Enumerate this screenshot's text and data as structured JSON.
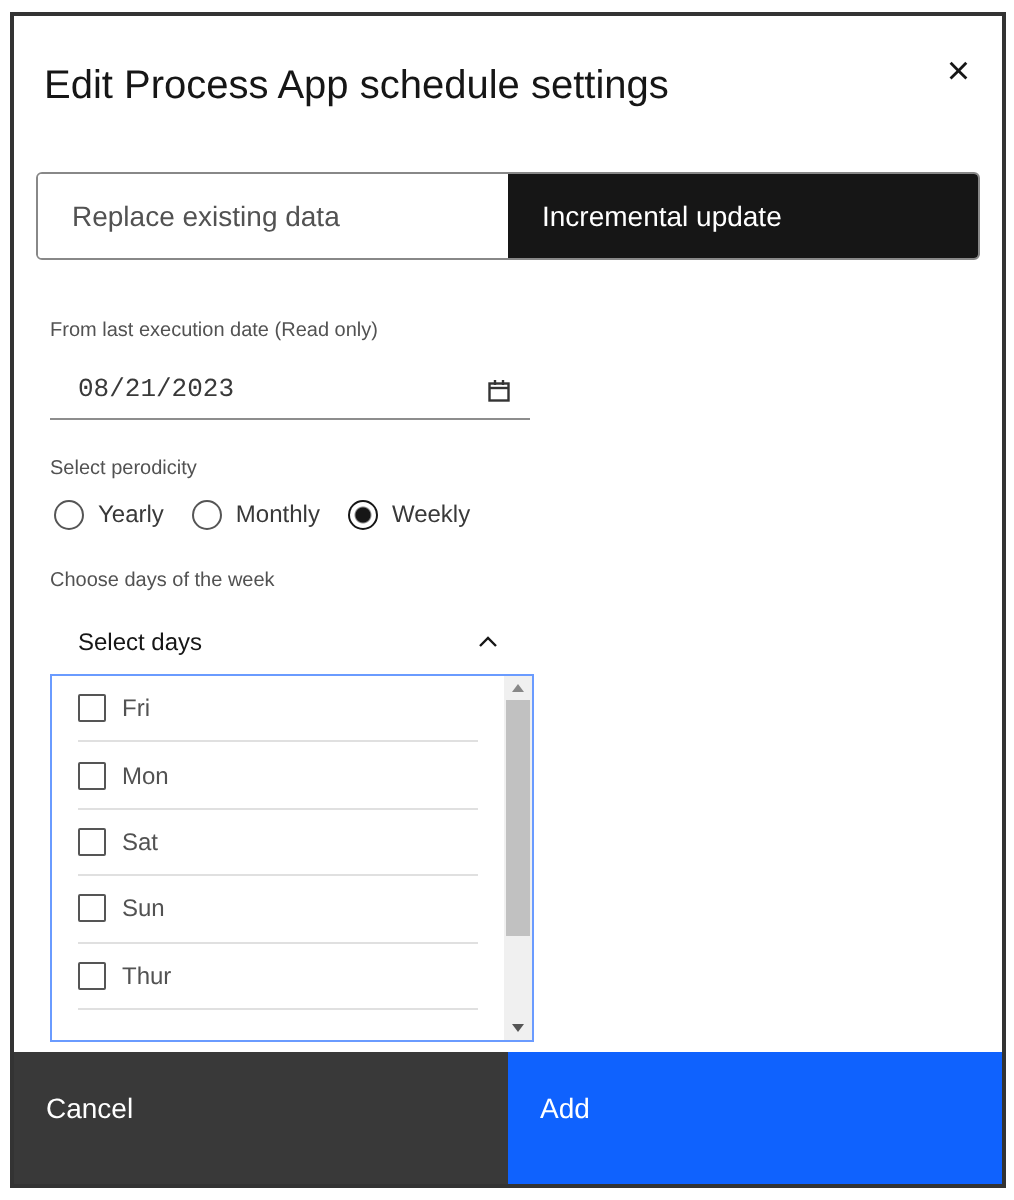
{
  "dialog": {
    "title": "Edit Process App schedule settings",
    "close": "×"
  },
  "tabs": [
    {
      "label": "Replace existing data",
      "selected": false
    },
    {
      "label": "Incremental update",
      "selected": true
    }
  ],
  "date_field": {
    "label": "From last execution date (Read only)",
    "value": "08/21/2023"
  },
  "periodicity": {
    "label": "Select perodicity",
    "options": [
      {
        "label": "Yearly",
        "selected": false
      },
      {
        "label": "Monthly",
        "selected": false
      },
      {
        "label": "Weekly",
        "selected": true
      }
    ]
  },
  "days": {
    "label": "Choose days of the week",
    "placeholder": "Select days",
    "expanded": true,
    "options": [
      {
        "label": "Fri",
        "checked": false
      },
      {
        "label": "Mon",
        "checked": false
      },
      {
        "label": "Sat",
        "checked": false
      },
      {
        "label": "Sun",
        "checked": false
      },
      {
        "label": "Thur",
        "checked": false
      }
    ]
  },
  "buttons": [
    {
      "label": "Cancel",
      "kind": "secondary"
    },
    {
      "label": "Add",
      "kind": "primary"
    }
  ]
}
